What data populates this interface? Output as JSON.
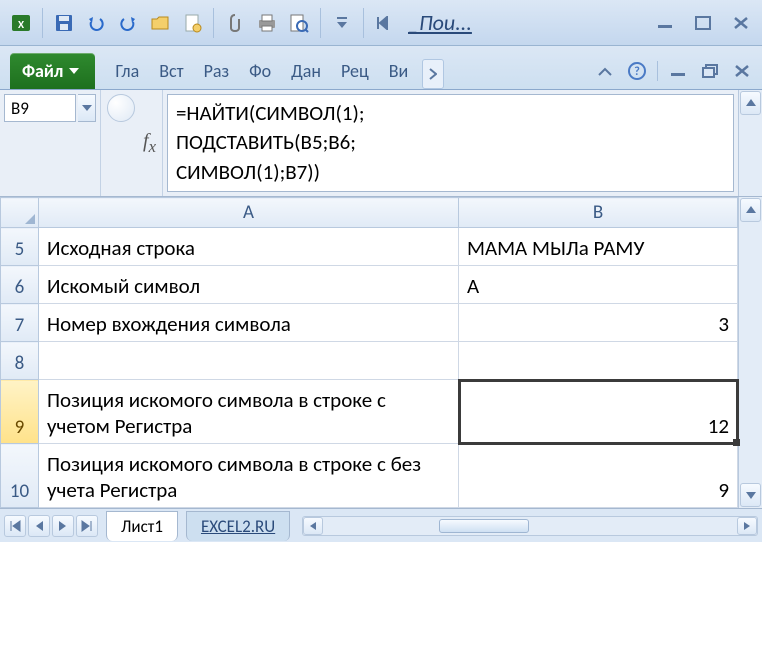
{
  "qat": {
    "search_label": "_Пои..."
  },
  "ribbon": {
    "file": "Файл",
    "tabs": [
      "Гла",
      "Вст",
      "Раз",
      "Фо",
      "Дан",
      "Рец",
      "Ви"
    ]
  },
  "namebox": "B9",
  "formula": "=НАЙТИ(СИМВОЛ(1);\nПОДСТАВИТЬ(B5;B6;\nСИМВОЛ(1);B7))",
  "columns": [
    "A",
    "B"
  ],
  "rows": [
    {
      "n": "5",
      "a": "Исходная строка",
      "b": "МАМА МЫЛа РАМУ",
      "b_align": "left",
      "tall": false
    },
    {
      "n": "6",
      "a": "Искомый символ",
      "b": "А",
      "b_align": "left",
      "tall": false
    },
    {
      "n": "7",
      "a": "Номер вхождения символа",
      "b": "3",
      "b_align": "right",
      "tall": false
    },
    {
      "n": "8",
      "a": "",
      "b": "",
      "b_align": "left",
      "tall": false
    },
    {
      "n": "9",
      "a": "Позиция искомого символа в строке с учетом Регистра",
      "b": "12",
      "b_align": "right",
      "tall": true,
      "active": true
    },
    {
      "n": "10",
      "a": "Позиция искомого символа в строке с без учета Регистра",
      "b": "9",
      "b_align": "right",
      "tall": true
    }
  ],
  "sheets": {
    "active": "Лист1",
    "link": "EXCEL2.RU"
  }
}
